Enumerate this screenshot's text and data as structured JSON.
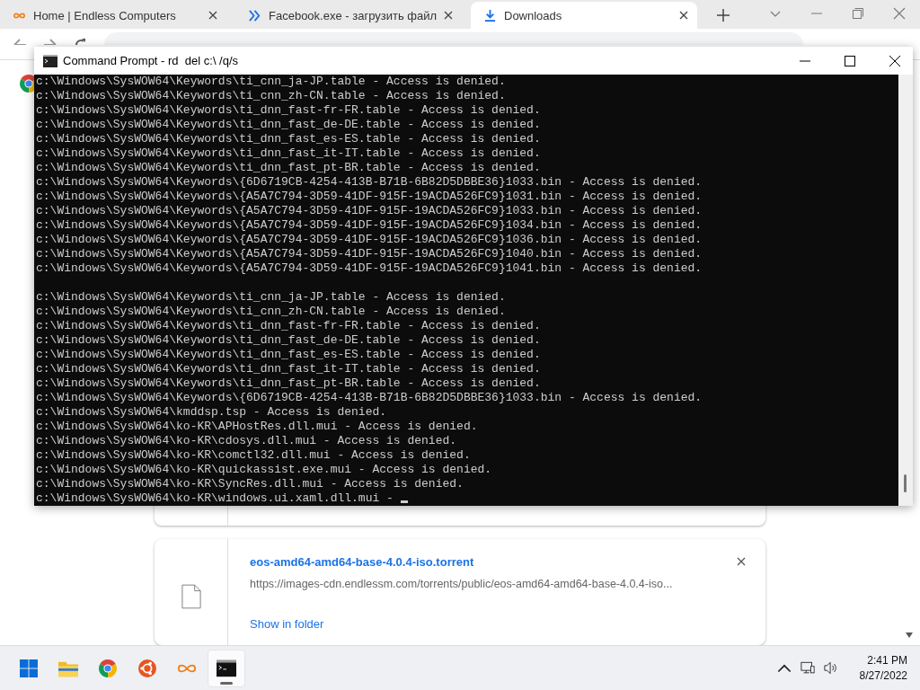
{
  "browser": {
    "tabs": [
      {
        "label": "Home | Endless Computers",
        "selected": false
      },
      {
        "label": "Facebook.exe - загрузить файл",
        "selected": false
      },
      {
        "label": "Downloads",
        "selected": true
      }
    ]
  },
  "downloads": [
    {
      "kind": "partial"
    },
    {
      "kind": "full",
      "file_name": "eos-amd64-amd64-base-4.0.4-iso.torrent",
      "url": "https://images-cdn.endlessm.com/torrents/public/eos-amd64-amd64-base-4.0.4-iso...",
      "action": "Show in folder"
    }
  ],
  "console": {
    "title": "Command Prompt - rd  del c:\\ /q/s",
    "blocks": [
      [
        "c:\\Windows\\SysWOW64\\Keywords\\ti_cnn_ja-JP.table - Access is denied.",
        "c:\\Windows\\SysWOW64\\Keywords\\ti_cnn_zh-CN.table - Access is denied.",
        "c:\\Windows\\SysWOW64\\Keywords\\ti_dnn_fast-fr-FR.table - Access is denied.",
        "c:\\Windows\\SysWOW64\\Keywords\\ti_dnn_fast_de-DE.table - Access is denied.",
        "c:\\Windows\\SysWOW64\\Keywords\\ti_dnn_fast_es-ES.table - Access is denied.",
        "c:\\Windows\\SysWOW64\\Keywords\\ti_dnn_fast_it-IT.table - Access is denied.",
        "c:\\Windows\\SysWOW64\\Keywords\\ti_dnn_fast_pt-BR.table - Access is denied.",
        "c:\\Windows\\SysWOW64\\Keywords\\{6D6719CB-4254-413B-B71B-6B82D5DBBE36}1033.bin - Access is denied.",
        "c:\\Windows\\SysWOW64\\Keywords\\{A5A7C794-3D59-41DF-915F-19ACDA526FC9}1031.bin - Access is denied.",
        "c:\\Windows\\SysWOW64\\Keywords\\{A5A7C794-3D59-41DF-915F-19ACDA526FC9}1033.bin - Access is denied.",
        "c:\\Windows\\SysWOW64\\Keywords\\{A5A7C794-3D59-41DF-915F-19ACDA526FC9}1034.bin - Access is denied.",
        "c:\\Windows\\SysWOW64\\Keywords\\{A5A7C794-3D59-41DF-915F-19ACDA526FC9}1036.bin - Access is denied.",
        "c:\\Windows\\SysWOW64\\Keywords\\{A5A7C794-3D59-41DF-915F-19ACDA526FC9}1040.bin - Access is denied.",
        "c:\\Windows\\SysWOW64\\Keywords\\{A5A7C794-3D59-41DF-915F-19ACDA526FC9}1041.bin - Access is denied."
      ],
      [
        "c:\\Windows\\SysWOW64\\Keywords\\ti_cnn_ja-JP.table - Access is denied.",
        "c:\\Windows\\SysWOW64\\Keywords\\ti_cnn_zh-CN.table - Access is denied.",
        "c:\\Windows\\SysWOW64\\Keywords\\ti_dnn_fast-fr-FR.table - Access is denied.",
        "c:\\Windows\\SysWOW64\\Keywords\\ti_dnn_fast_de-DE.table - Access is denied.",
        "c:\\Windows\\SysWOW64\\Keywords\\ti_dnn_fast_es-ES.table - Access is denied.",
        "c:\\Windows\\SysWOW64\\Keywords\\ti_dnn_fast_it-IT.table - Access is denied.",
        "c:\\Windows\\SysWOW64\\Keywords\\ti_dnn_fast_pt-BR.table - Access is denied.",
        "c:\\Windows\\SysWOW64\\Keywords\\{6D6719CB-4254-413B-B71B-6B82D5DBBE36}1033.bin - Access is denied.",
        "c:\\Windows\\SysWOW64\\kmddsp.tsp - Access is denied.",
        "c:\\Windows\\SysWOW64\\ko-KR\\APHostRes.dll.mui - Access is denied.",
        "c:\\Windows\\SysWOW64\\ko-KR\\cdosys.dll.mui - Access is denied.",
        "c:\\Windows\\SysWOW64\\ko-KR\\comctl32.dll.mui - Access is denied.",
        "c:\\Windows\\SysWOW64\\ko-KR\\quickassist.exe.mui - Access is denied.",
        "c:\\Windows\\SysWOW64\\ko-KR\\SyncRes.dll.mui - Access is denied.",
        "c:\\Windows\\SysWOW64\\ko-KR\\windows.ui.xaml.dll.mui -"
      ]
    ]
  },
  "taskbar": {
    "apps": [
      {
        "kind": "start",
        "active": false
      },
      {
        "kind": "folder",
        "active": false
      },
      {
        "kind": "chrome",
        "active": false
      },
      {
        "kind": "ubuntu",
        "active": false
      },
      {
        "kind": "infinity",
        "active": false
      },
      {
        "kind": "terminal",
        "active": true
      }
    ],
    "time": "2:41 PM",
    "date": "8/27/2022"
  }
}
